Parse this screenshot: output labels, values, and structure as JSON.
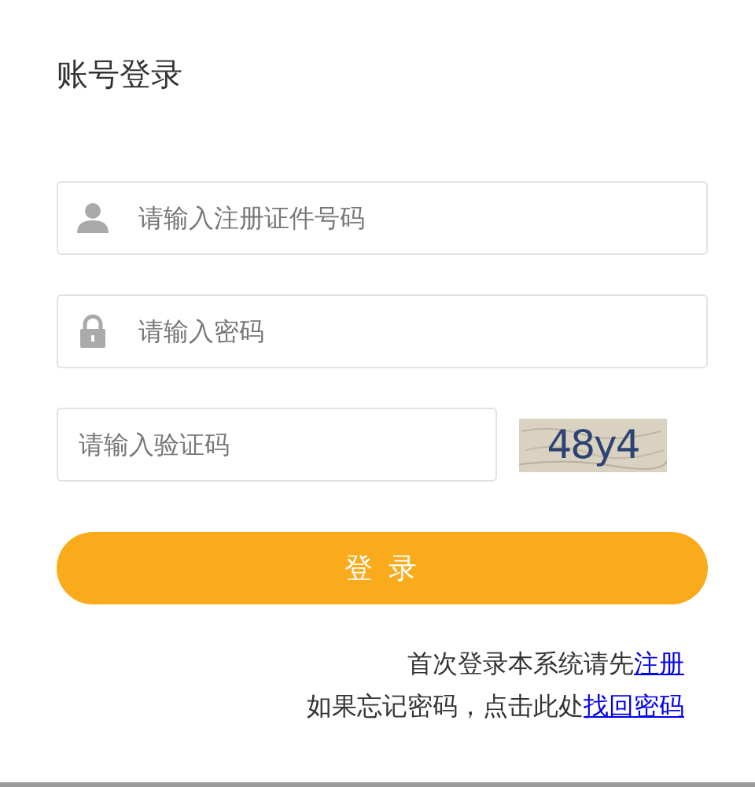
{
  "title": "账号登录",
  "fields": [
    {
      "kind": "user",
      "placeholder": "请输入注册证件号码"
    },
    {
      "kind": "lock",
      "placeholder": "请输入密码"
    }
  ],
  "captcha": {
    "placeholder": "请输入验证码",
    "code": "48y4"
  },
  "button": "登 录",
  "notes": [
    {
      "text": "首次登录本系统请先",
      "link": "注册"
    },
    {
      "text": "如果忘记密码，点击此处",
      "link": "找回密码"
    }
  ]
}
